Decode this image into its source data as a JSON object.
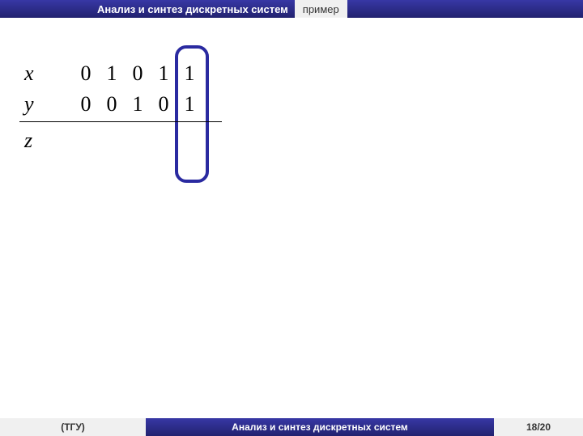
{
  "header": {
    "title": "Анализ и синтез дискретных систем",
    "tab": "пример"
  },
  "table": {
    "rows": [
      {
        "label": "x",
        "cells": [
          "0",
          "1",
          "0",
          "1",
          "1"
        ]
      },
      {
        "label": "y",
        "cells": [
          "0",
          "0",
          "1",
          "0",
          "1"
        ]
      },
      {
        "label": "z",
        "cells": [
          "",
          "",
          "",
          "",
          ""
        ]
      }
    ]
  },
  "footer": {
    "affiliation": "(ТГУ)",
    "title": "Анализ и синтез дискретных систем",
    "page": "18/20"
  }
}
